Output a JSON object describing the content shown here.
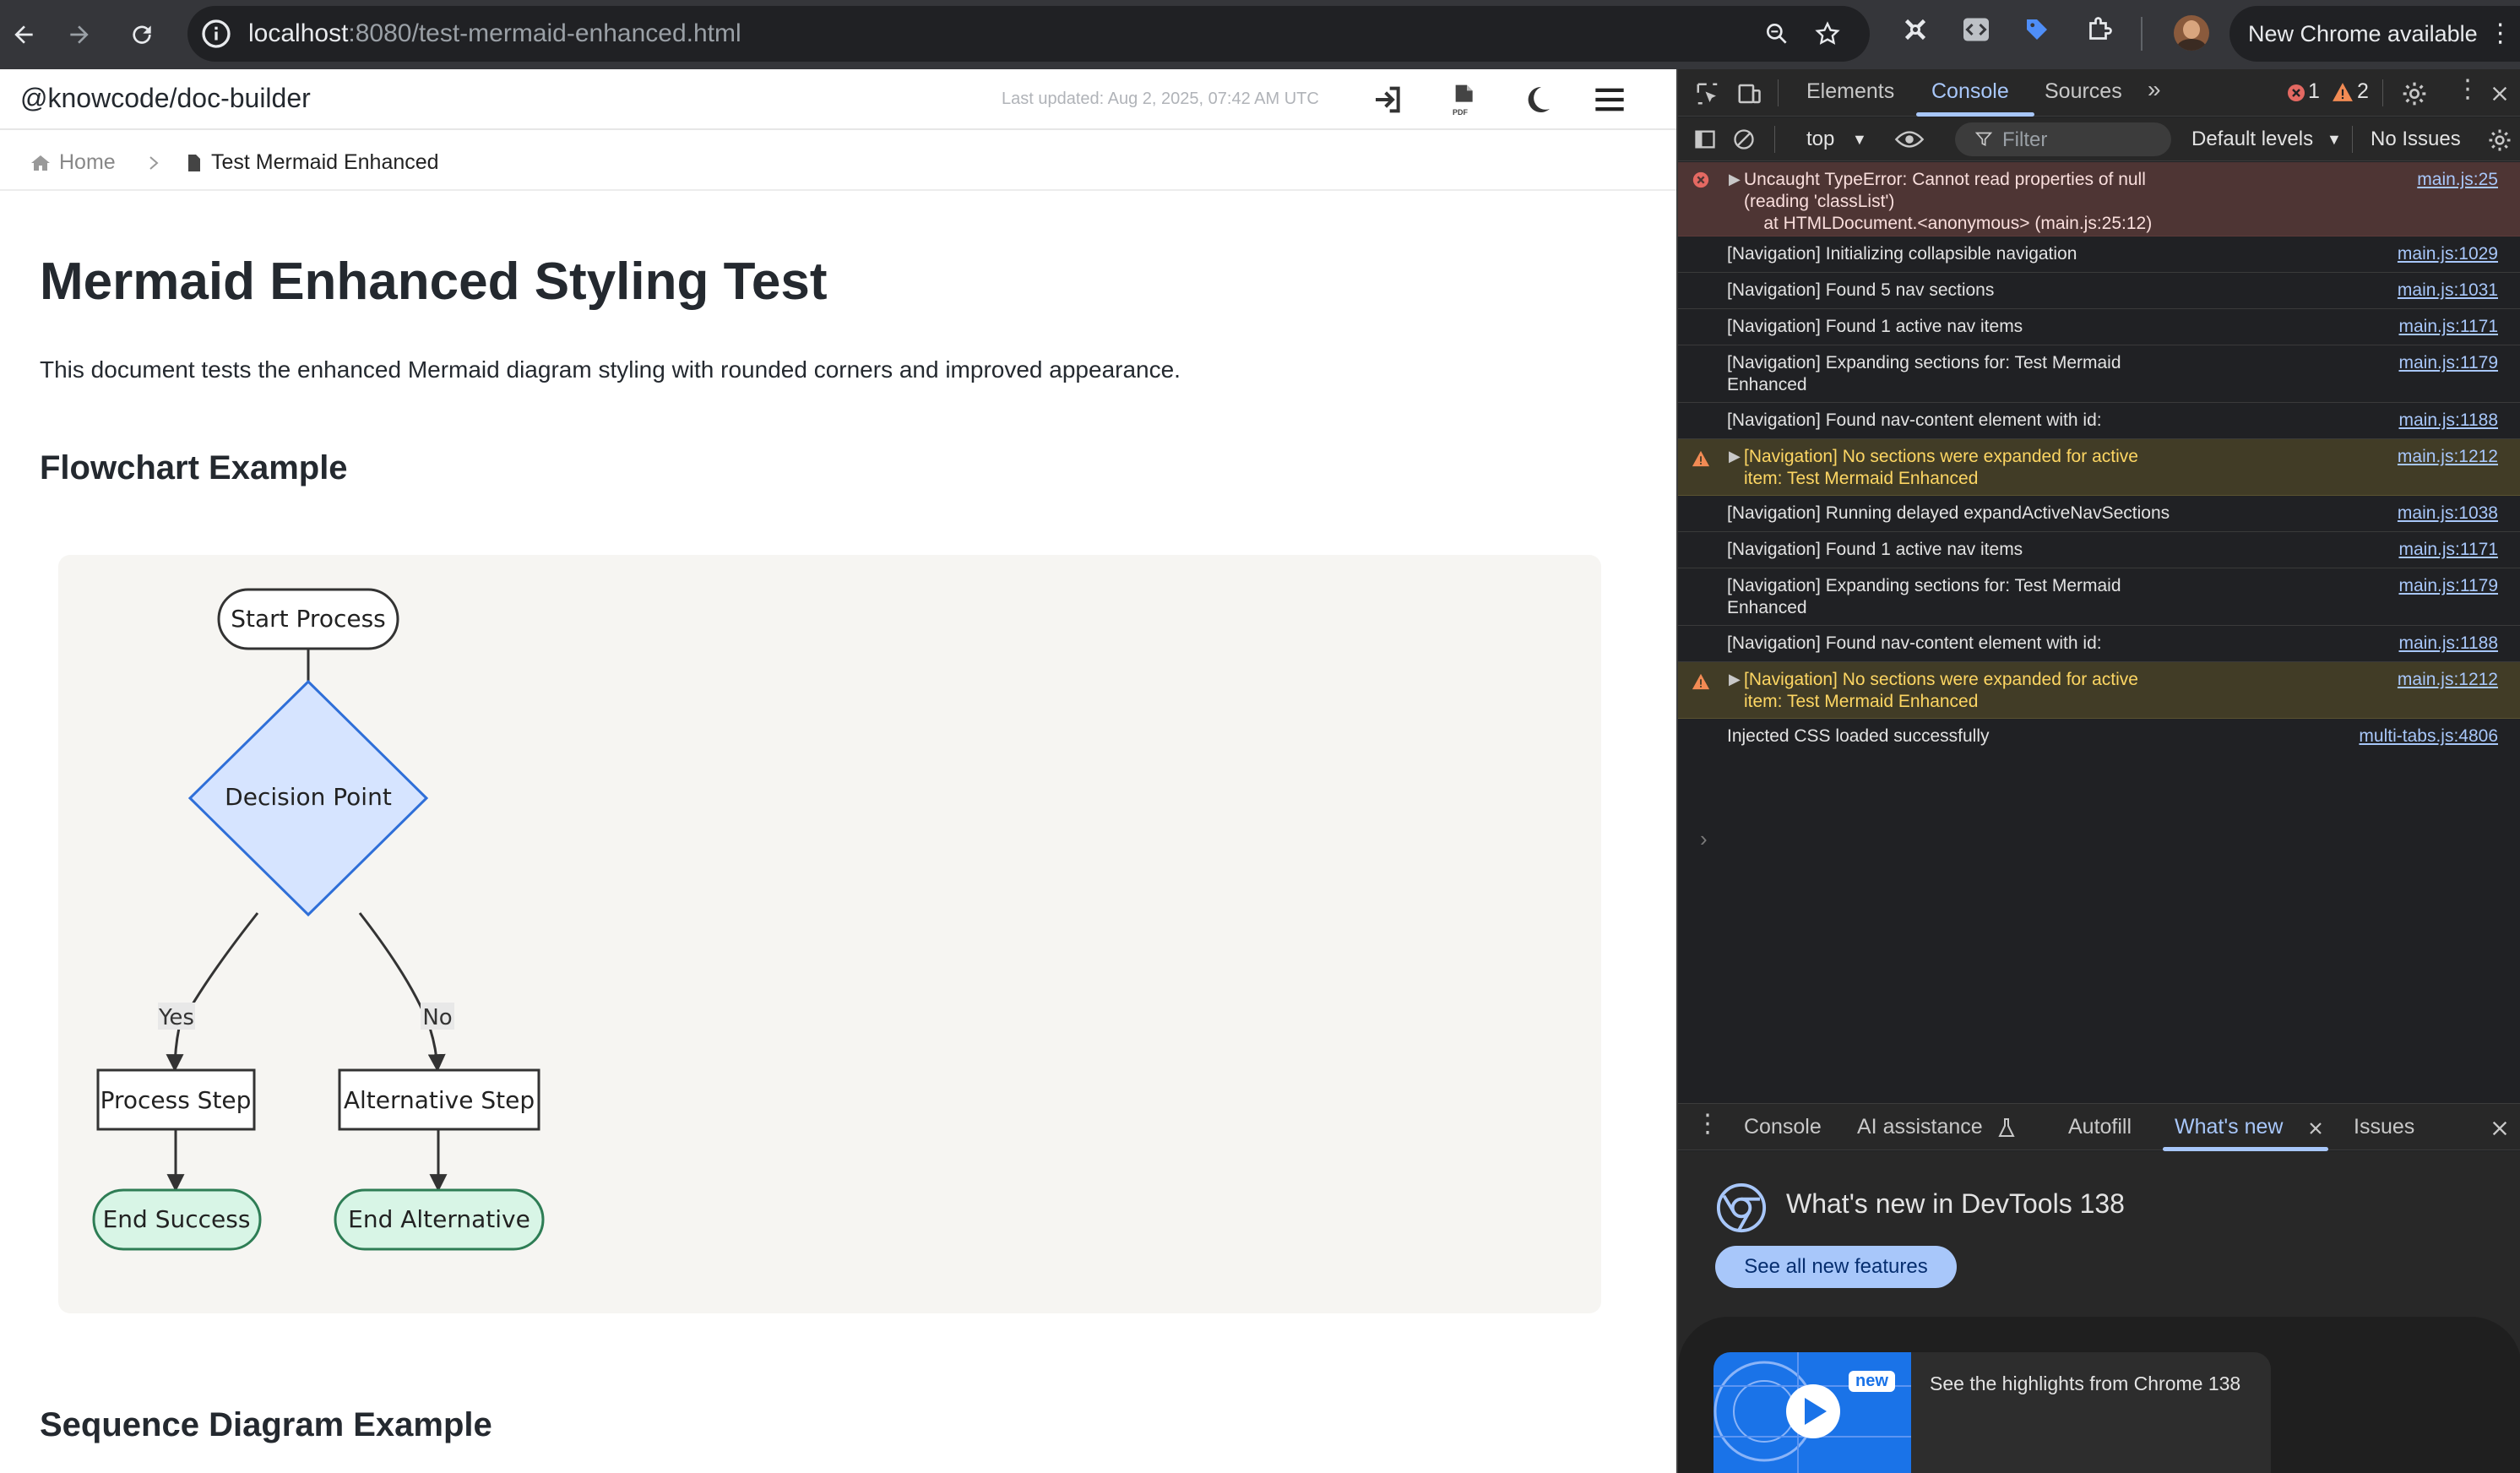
{
  "browser": {
    "url_host": "localhost",
    "url_path": ":8080/test-mermaid-enhanced.html",
    "update_notice": "New Chrome available"
  },
  "site": {
    "title": "@knowcode/doc-builder",
    "last_updated": "Last updated: Aug 2, 2025, 07:42 AM UTC",
    "pdf_label": "PDF"
  },
  "breadcrumb": {
    "home": "Home",
    "current": "Test Mermaid Enhanced"
  },
  "content": {
    "title": "Mermaid Enhanced Styling Test",
    "intro": "This document tests the enhanced Mermaid diagram styling with rounded corners and improved appearance.",
    "flowchart_heading": "Flowchart Example",
    "sequence_heading": "Sequence Diagram Example"
  },
  "flowchart": {
    "start": "Start Process",
    "decision": "Decision Point",
    "yes": "Yes",
    "no": "No",
    "process": "Process Step",
    "alternative": "Alternative Step",
    "end_success": "End Success",
    "end_alternative": "End Alternative",
    "colors": {
      "decision_fill": "#d6e4ff",
      "decision_stroke": "#2f6fd8",
      "terminal_fill": "#d8f5e6",
      "terminal_stroke": "#2e7d55"
    }
  },
  "devtools": {
    "tabs": [
      "Elements",
      "Console",
      "Sources"
    ],
    "error_count": "1",
    "warning_count": "2",
    "context": "top",
    "filter_placeholder": "Filter",
    "levels": "Default levels",
    "issues": "No Issues",
    "logs": [
      {
        "msg": "Uncaught TypeError: Cannot read properties of null\n(reading 'classList')\n    at HTMLDocument.<anonymous> (main.js:25:12)",
        "src": "main.js:25"
      },
      {
        "msg": "[Navigation] Initializing collapsible navigation",
        "src": "main.js:1029"
      },
      {
        "msg": "[Navigation] Found 5 nav sections",
        "src": "main.js:1031"
      },
      {
        "msg": "[Navigation] Found 1 active nav items",
        "src": "main.js:1171"
      },
      {
        "msg": "[Navigation] Expanding sections for: Test Mermaid\nEnhanced",
        "src": "main.js:1179"
      },
      {
        "msg": "[Navigation] Found nav-content element with id:",
        "src": "main.js:1188"
      },
      {
        "msg": "[Navigation] No sections were expanded for active\nitem: Test Mermaid Enhanced",
        "src": "main.js:1212"
      },
      {
        "msg": "[Navigation] Running delayed expandActiveNavSections",
        "src": "main.js:1038"
      },
      {
        "msg": "[Navigation] Found 1 active nav items",
        "src": "main.js:1171"
      },
      {
        "msg": "[Navigation] Expanding sections for: Test Mermaid\nEnhanced",
        "src": "main.js:1179"
      },
      {
        "msg": "[Navigation] Found nav-content element with id:",
        "src": "main.js:1188"
      },
      {
        "msg": "[Navigation] No sections were expanded for active\nitem: Test Mermaid Enhanced",
        "src": "main.js:1212"
      },
      {
        "msg": "Injected CSS loaded successfully",
        "src": "multi-tabs.js:4806"
      }
    ],
    "drawer_tabs": [
      "Console",
      "AI assistance",
      "Autofill",
      "What's new",
      "Issues"
    ],
    "whats_new_title": "What's new in DevTools 138",
    "whats_new_button": "See all new features",
    "card_badge": "new",
    "card_text": "See the highlights from Chrome 138"
  }
}
